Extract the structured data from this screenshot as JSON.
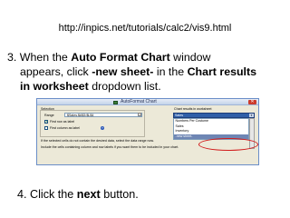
{
  "url": "http://inpics.net/tutorials/calc2/vis9.html",
  "step3": {
    "part1": "3. When the ",
    "bold1": "Auto Format Chart",
    "part2": " window",
    "part3": "appears, click ",
    "bold2": "-new sheet-",
    "part4": " in the ",
    "bold3": "Chart results",
    "bold4": "in worksheet",
    "part5": " dropdown list."
  },
  "step4": {
    "part1": "4. Click the ",
    "bold1": "next",
    "part2": " button."
  },
  "dialog": {
    "title": "AutoFormat Chart",
    "close_glyph": "✕",
    "selection_label": "Selection",
    "range_label": "Range",
    "range_value": "$Sales.$A$3:$L$4",
    "first_row_label": "First row as label",
    "first_column_label": "First column as label",
    "checkmark": "✔",
    "help_glyph": "?",
    "note1": "If the selected cells do not contain the desired data, select the data range now.",
    "note2": "Include the cells containing column and row labels if you want them to be included in your chart.",
    "results_label": "Chart results in worksheet",
    "results_selected": "Sales",
    "arrow_glyph": "▼",
    "options": [
      "Numbers Per Costume",
      "Sales",
      "Inventory",
      "-new sheet-"
    ]
  }
}
